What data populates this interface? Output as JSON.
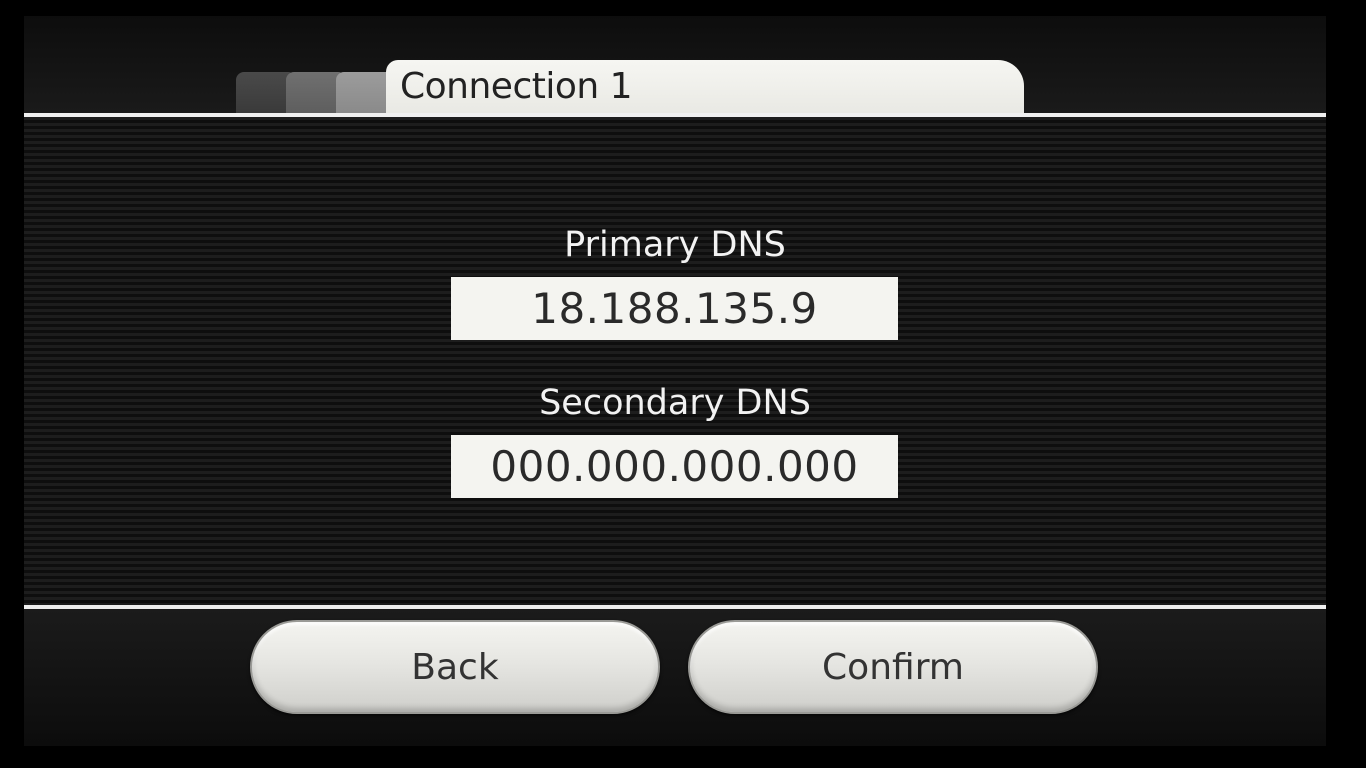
{
  "header": {
    "title": "Connection 1"
  },
  "fields": {
    "primary_dns": {
      "label": "Primary DNS",
      "value": "18.188.135.9"
    },
    "secondary_dns": {
      "label": "Secondary DNS",
      "value": "000.000.000.000"
    }
  },
  "buttons": {
    "back_label": "Back",
    "confirm_label": "Confirm"
  },
  "colors": {
    "background": "#000000",
    "panel_light": "#f4f4f0",
    "text_dark": "#222222",
    "text_light": "#f2f2f2"
  }
}
